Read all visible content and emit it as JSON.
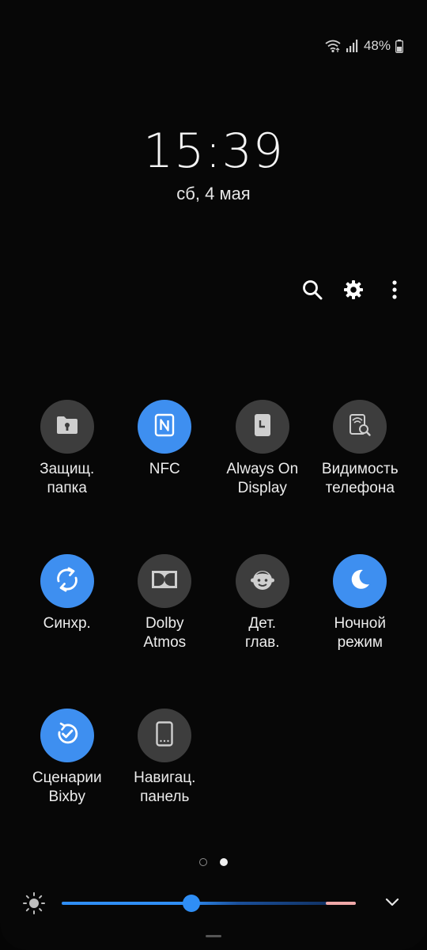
{
  "status_bar": {
    "battery_percent_label": "48%",
    "icons": [
      "wifi-calling-icon",
      "signal-icon",
      "battery-icon"
    ]
  },
  "lock": {
    "time": "15:39",
    "date": "сб, 4 мая"
  },
  "header_actions": [
    "search-icon",
    "gear-icon",
    "more-options-icon"
  ],
  "tiles": [
    {
      "label": "Защищ.\nпапка",
      "icon": "secure-folder-icon",
      "active": false
    },
    {
      "label": "NFC",
      "icon": "nfc-icon",
      "active": true
    },
    {
      "label": "Always On\nDisplay",
      "icon": "always-on-display-icon",
      "active": false
    },
    {
      "label": "Видимость\nтелефона",
      "icon": "phone-visibility-icon",
      "active": false
    },
    {
      "label": "Синхр.",
      "icon": "sync-icon",
      "active": true
    },
    {
      "label": "Dolby\nAtmos",
      "icon": "dolby-icon",
      "active": false
    },
    {
      "label": "Дет.\nглав.",
      "icon": "kids-home-icon",
      "active": false
    },
    {
      "label": "Ночной\nрежим",
      "icon": "night-mode-icon",
      "active": true
    },
    {
      "label": "Сценарии\nBixby",
      "icon": "bixby-routines-icon",
      "active": true
    },
    {
      "label": "Навигац.\nпанель",
      "icon": "navigation-bar-icon",
      "active": false
    }
  ],
  "pager": {
    "pages": 2,
    "current_page": 2
  },
  "brightness": {
    "level_fraction": 0.44
  },
  "colors": {
    "accent": "#3e8ff0",
    "tile_off": "#3d3d3d",
    "background": "#070707"
  }
}
